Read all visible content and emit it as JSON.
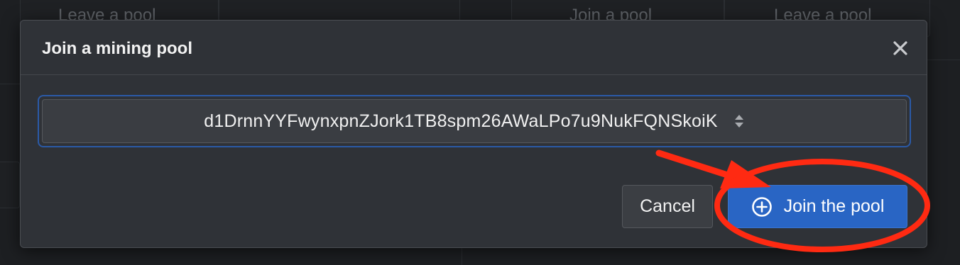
{
  "background": {
    "cells": [
      {
        "label": "Leave a pool"
      },
      {
        "label": "Join a pool"
      },
      {
        "label": "Leave a pool"
      }
    ]
  },
  "modal": {
    "title": "Join a mining pool",
    "close_icon": "close-icon",
    "address_value": "d1DrnnYYFwynxpnZJork1TB8spm26AWaLPo7u9NukFQNSkoiK",
    "address_icon": "updown-chevron-icon",
    "cancel_label": "Cancel",
    "join_label": "Join the pool",
    "join_icon": "plus-circle-icon"
  },
  "colors": {
    "modal_bg": "#2f3237",
    "primary": "#2965c4",
    "annotation": "#ff2a12",
    "select_focus": "#2b5aa7"
  }
}
